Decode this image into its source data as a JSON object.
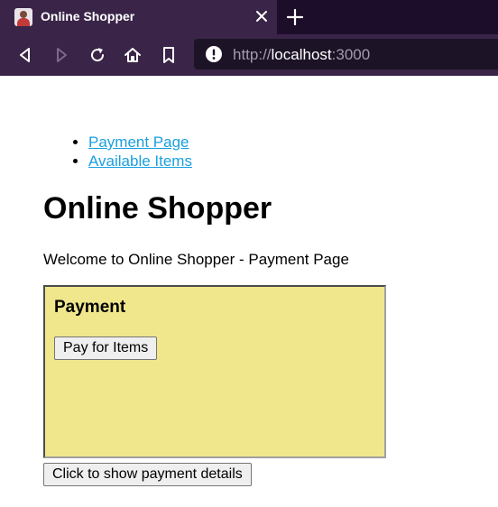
{
  "browser": {
    "tab_title": "Online Shopper",
    "url_scheme": "http://",
    "url_host": "localhost",
    "url_port": ":3000"
  },
  "nav": {
    "items": [
      {
        "label": "Payment Page"
      },
      {
        "label": "Available Items"
      }
    ]
  },
  "page": {
    "title": "Online Shopper",
    "welcome": "Welcome to Online Shopper - Payment Page"
  },
  "payment": {
    "heading": "Payment",
    "pay_button": "Pay for Items",
    "background_color": "#f0e68c"
  },
  "details_button": "Click to show payment details",
  "colors": {
    "chrome_dark": "#1c0e2a",
    "chrome": "#3a2448",
    "link": "#1a9fdf"
  }
}
